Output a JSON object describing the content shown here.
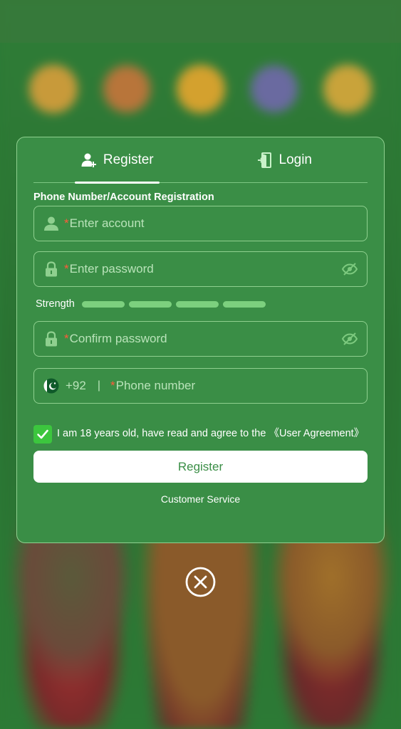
{
  "tabs": {
    "register_label": "Register",
    "login_label": "Login"
  },
  "form": {
    "section_title": "Phone Number/Account Registration",
    "required_mark": "*",
    "account_placeholder": "Enter account",
    "password_placeholder": "Enter password",
    "strength_label": "Strength",
    "confirm_placeholder": "Confirm password",
    "dial_code": "+92",
    "separator": "|",
    "phone_placeholder": "Phone number",
    "agree_text": "I am 18 years old, have read and agree to the 《User Agreement》",
    "agree_checked": true,
    "register_button": "Register",
    "customer_service": "Customer Service"
  },
  "icons": {
    "register_tab": "user-plus-icon",
    "login_tab": "door-enter-icon",
    "account": "user-icon",
    "password": "lock-icon",
    "visibility": "eye-off-icon",
    "flag": "pakistan-flag-icon",
    "checkbox": "check-icon",
    "close": "close-circle-icon"
  },
  "colors": {
    "modal_bg": "#3a8e46",
    "border": "#8fd08f",
    "strength_bar": "#7cd07e",
    "checkbox": "#3cc63e",
    "required": "#ff5a3a",
    "button_bg": "#ffffff",
    "button_text": "#3a8e46"
  }
}
